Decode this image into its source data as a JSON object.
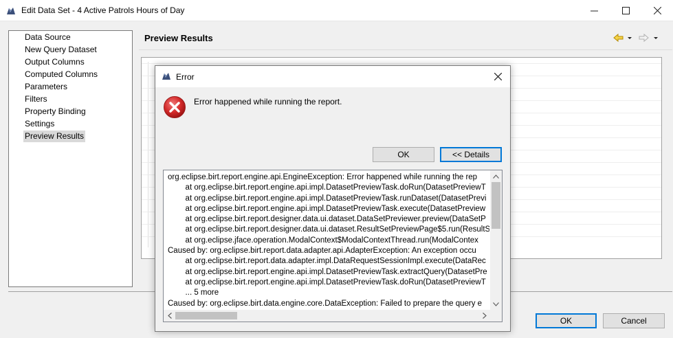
{
  "window": {
    "title": "Edit Data Set - 4 Active Patrols Hours of Day"
  },
  "nav": {
    "items": [
      {
        "label": "Data Source"
      },
      {
        "label": "New Query Dataset"
      },
      {
        "label": "Output Columns"
      },
      {
        "label": "Computed Columns"
      },
      {
        "label": "Parameters"
      },
      {
        "label": "Filters"
      },
      {
        "label": "Property Binding"
      },
      {
        "label": "Settings"
      },
      {
        "label": "Preview Results"
      }
    ],
    "selected": "Preview Results"
  },
  "content": {
    "section_title": "Preview Results"
  },
  "footer": {
    "ok_label": "OK",
    "cancel_label": "Cancel"
  },
  "error_dialog": {
    "title": "Error",
    "message": "Error happened while running the report.",
    "ok_label": "OK",
    "details_label": "<< Details",
    "details_lines": [
      "org.eclipse.birt.report.engine.api.EngineException: Error happened while running the rep",
      "        at org.eclipse.birt.report.engine.api.impl.DatasetPreviewTask.doRun(DatasetPreviewT",
      "        at org.eclipse.birt.report.engine.api.impl.DatasetPreviewTask.runDataset(DatasetPrevi",
      "        at org.eclipse.birt.report.engine.api.impl.DatasetPreviewTask.execute(DatasetPreview",
      "        at org.eclipse.birt.report.designer.data.ui.dataset.DataSetPreviewer.preview(DataSetP",
      "        at org.eclipse.birt.report.designer.data.ui.dataset.ResultSetPreviewPage$5.run(ResultS",
      "        at org.eclipse.jface.operation.ModalContext$ModalContextThread.run(ModalContex",
      "Caused by: org.eclipse.birt.report.data.adapter.api.AdapterException: An exception occu",
      "        at org.eclipse.birt.report.data.adapter.impl.DataRequestSessionImpl.execute(DataRec",
      "        at org.eclipse.birt.report.engine.api.impl.DatasetPreviewTask.extractQuery(DatasetPre",
      "        at org.eclipse.birt.report.engine.api.impl.DatasetPreviewTask.doRun(DatasetPreviewT",
      "        ... 5 more",
      "Caused by: org.eclipse.birt.data.engine.core.DataException: Failed to prepare the query e"
    ]
  },
  "colors": {
    "error_red": "#d9343a",
    "focus_blue": "#0078d7",
    "arrow_yellow": "#e8b600"
  }
}
